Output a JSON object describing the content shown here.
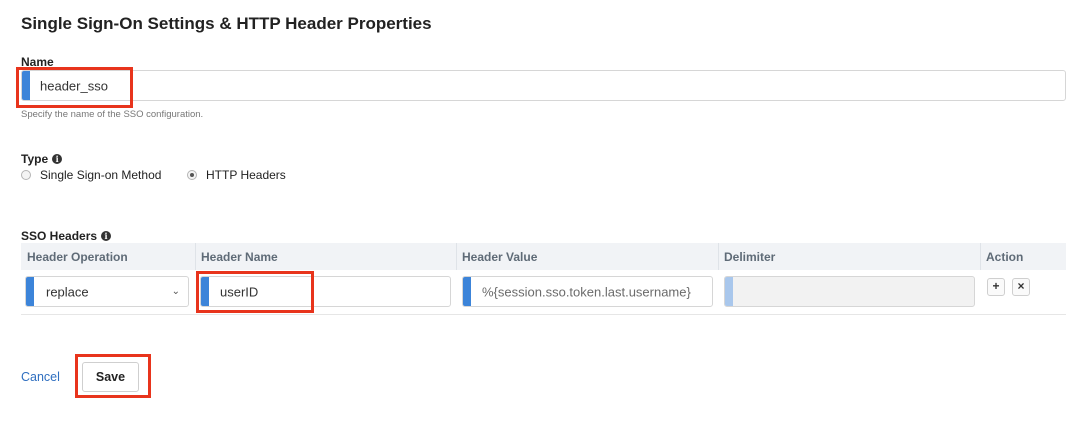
{
  "page": {
    "title": "Single Sign-On Settings & HTTP Header Properties"
  },
  "name_field": {
    "label": "Name",
    "value": "header_sso",
    "help": "Specify the name of the SSO configuration."
  },
  "type_field": {
    "label": "Type",
    "options": [
      {
        "label": "Single Sign-on Method",
        "selected": false
      },
      {
        "label": "HTTP Headers",
        "selected": true
      }
    ]
  },
  "sso_headers": {
    "label": "SSO Headers",
    "columns": [
      "Header Operation",
      "Header Name",
      "Header Value",
      "Delimiter",
      "Action"
    ],
    "rows": [
      {
        "operation": "replace",
        "name": "userID",
        "value_placeholder": "%{session.sso.token.last.username}",
        "delimiter": ""
      }
    ]
  },
  "actions": {
    "cancel_label": "Cancel",
    "save_label": "Save",
    "add_icon": "+",
    "remove_icon": "×"
  },
  "colors": {
    "accent": "#3c84d9",
    "highlight": "#e8341c",
    "link": "#2f6fc0"
  }
}
